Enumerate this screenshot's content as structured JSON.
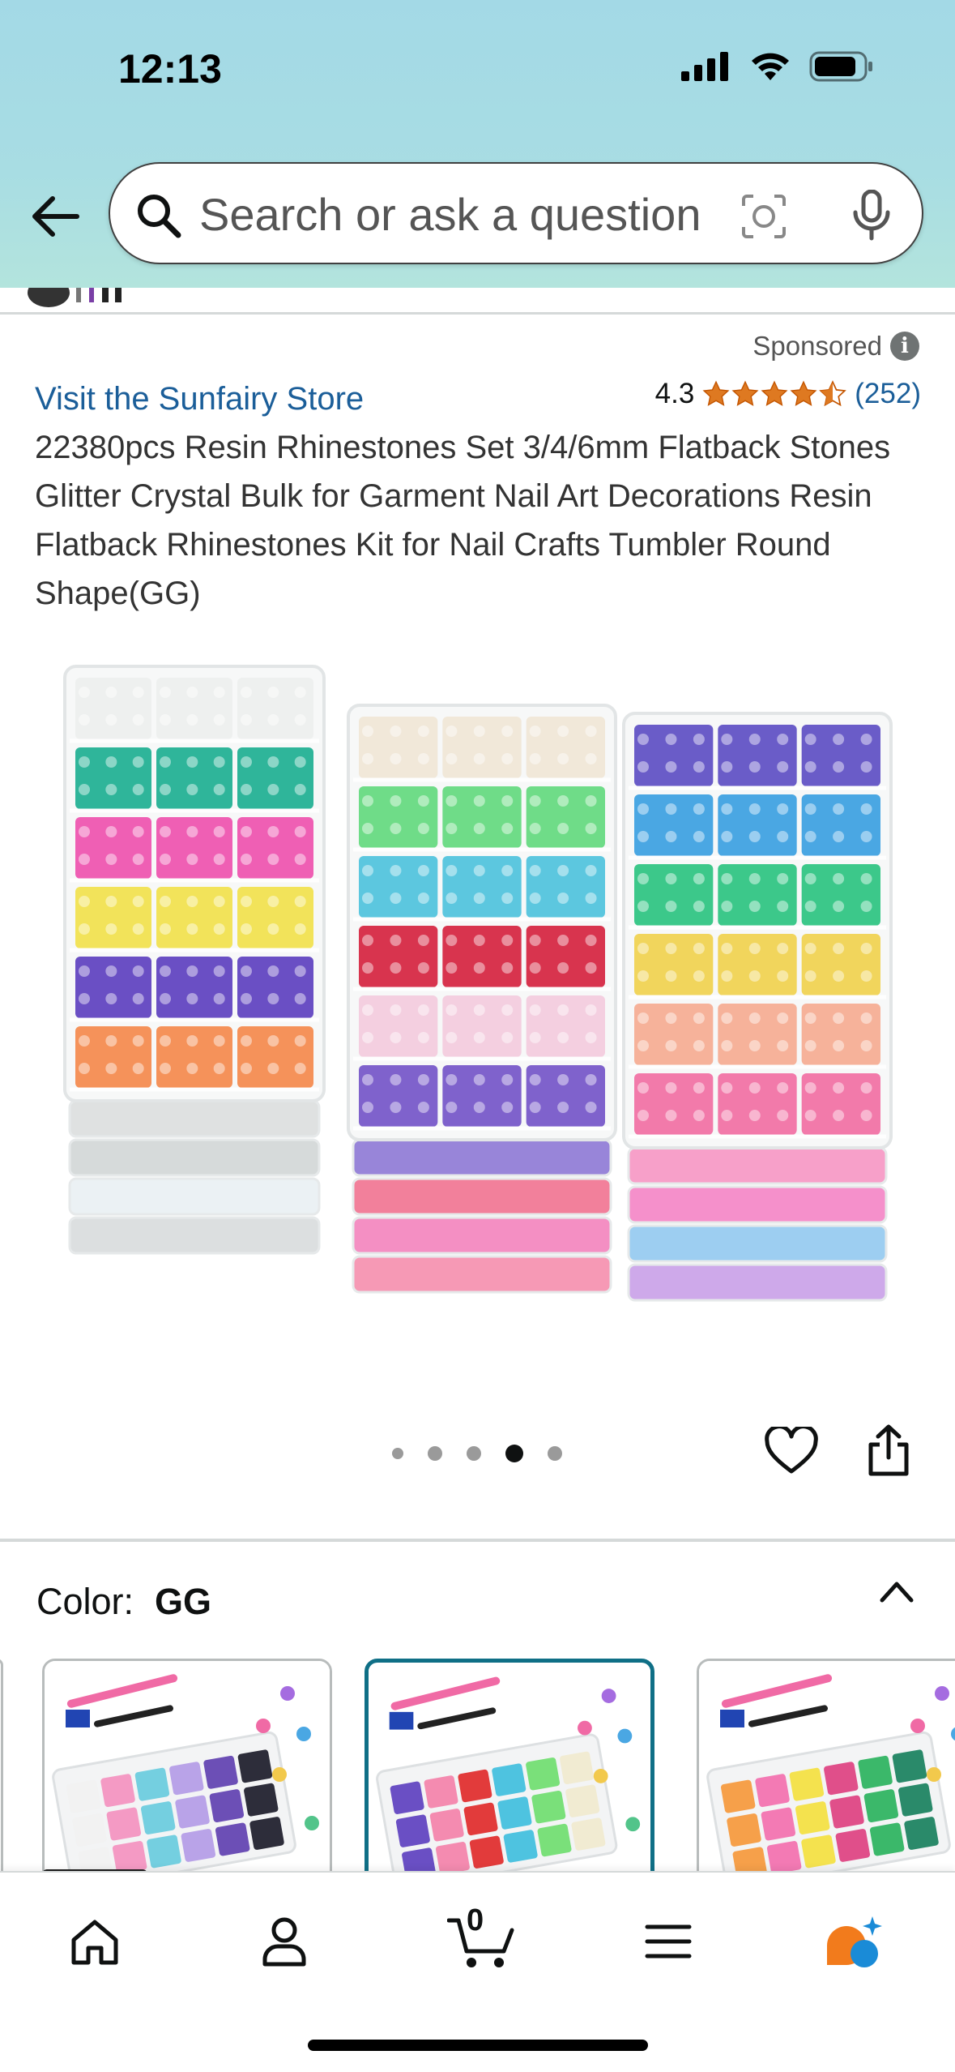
{
  "status": {
    "time": "12:13"
  },
  "search": {
    "placeholder": "Search or ask a question"
  },
  "product": {
    "sponsored": "Sponsored",
    "store_link": "Visit the Sunfairy Store",
    "rating": "4.3",
    "rating_count": "(252)",
    "stars_value": 4.3,
    "title": "22380pcs Resin Rhinestones Set 3/4/6mm Flatback Stones Glitter Crystal Bulk for Garment Nail Art Decorations Resin Flatback Rhinestones Kit for Nail Crafts Tumbler Round Shape(GG)"
  },
  "gallery": {
    "image_count": 5,
    "active_index": 3
  },
  "color": {
    "label": "Color:",
    "value": "GG"
  },
  "tabbar": {
    "cart_count": "0"
  },
  "colors": {
    "link": "#1b5e99",
    "star": "#de7921",
    "selected_border": "#0f6f86",
    "rufus_orange": "#f27b1c",
    "rufus_blue": "#1a8bd7"
  },
  "icons": [
    "back-arrow-icon",
    "search-icon",
    "camera-lens-icon",
    "microphone-icon",
    "info-icon",
    "heart-icon",
    "share-icon",
    "chevron-up-icon",
    "home-icon",
    "account-icon",
    "cart-icon",
    "menu-icon",
    "rufus-ai-icon"
  ]
}
